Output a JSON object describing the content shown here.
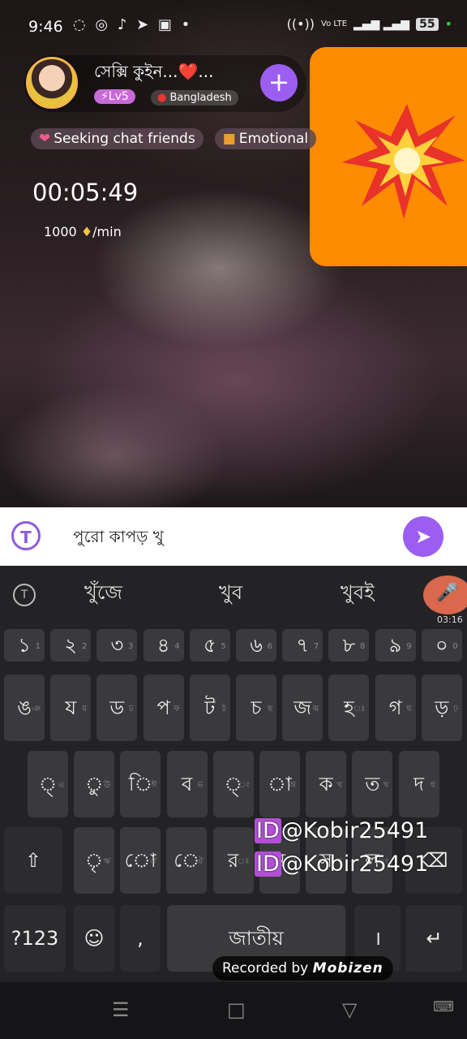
{
  "status_bar": {
    "time": "9:46",
    "app_icons": "◌ ◎ ♪ ➤ ▣ •",
    "network": "Vo LTE",
    "battery": "55",
    "signal": "▂▄▆ ▂▄▆"
  },
  "profile": {
    "name": "সেক্সি কুইন...❤️...",
    "level": "Lv5",
    "country": "Bangladesh",
    "add_label": "+"
  },
  "tags": [
    {
      "label": "Seeking chat friends"
    },
    {
      "label": "Emotional"
    }
  ],
  "call": {
    "timer": "00:05:49",
    "rate_value": "1000",
    "rate_unit": "/min",
    "gem_icon": "diamond-icon"
  },
  "overlay": {
    "emoji_icon": "explosion-icon",
    "color": "#ff8c00"
  },
  "input": {
    "value": "পুরো কাপড় খু",
    "translate_icon": "T",
    "send_icon": "send-icon"
  },
  "keyboard": {
    "suggestions": [
      "খুঁজে",
      "খুব",
      "খুবই"
    ],
    "recording_time": "03:16",
    "row_numbers": [
      "১",
      "২",
      "৩",
      "৪",
      "৫",
      "৬",
      "৭",
      "৮",
      "৯",
      "০"
    ],
    "row_numbers_hint": [
      "1",
      "2",
      "3",
      "4",
      "5",
      "6",
      "7",
      "8",
      "9",
      "0"
    ],
    "row1": [
      "ঙ",
      "য",
      "ড",
      "প",
      "ট",
      "চ",
      "জ",
      "হ",
      "গ",
      "ড়"
    ],
    "row1_hint": [
      "ঞ",
      "য়",
      "ঢ",
      "ফ",
      "ঠ",
      "ছ",
      "ঝ",
      "ঃ",
      "ঘ",
      "ঢ়"
    ],
    "row2": [
      "্",
      "ু",
      "ি",
      "ব",
      "্",
      "া",
      "ক",
      "ত",
      "দ"
    ],
    "row2_hint": [
      "এ",
      "ঊ",
      "ঈ",
      "ভ",
      "ং",
      "অ",
      "খ",
      "থ",
      "ধ"
    ],
    "row3": [
      "ৃ",
      "ো",
      "ে",
      "র",
      "ন",
      "স",
      "ল"
    ],
    "row3_hint": [
      "ঋ",
      "ঔ",
      "ঐ",
      "ঃ",
      "ণ",
      "ষ",
      "ং"
    ],
    "shift": "⇧",
    "delete": "⌫",
    "mode": "?123",
    "emoji": "☺",
    "comma": ",",
    "space": "জাতীয়",
    "period": "।",
    "enter": "↵"
  },
  "watermark": {
    "prefix": "ID",
    "handle": "@Kobir25491",
    "recorded_by": "Recorded by",
    "brand": "Mobizen"
  },
  "navbar": {
    "menu": "☰",
    "home": "□",
    "back": "▽",
    "keyboard": "⌨"
  }
}
